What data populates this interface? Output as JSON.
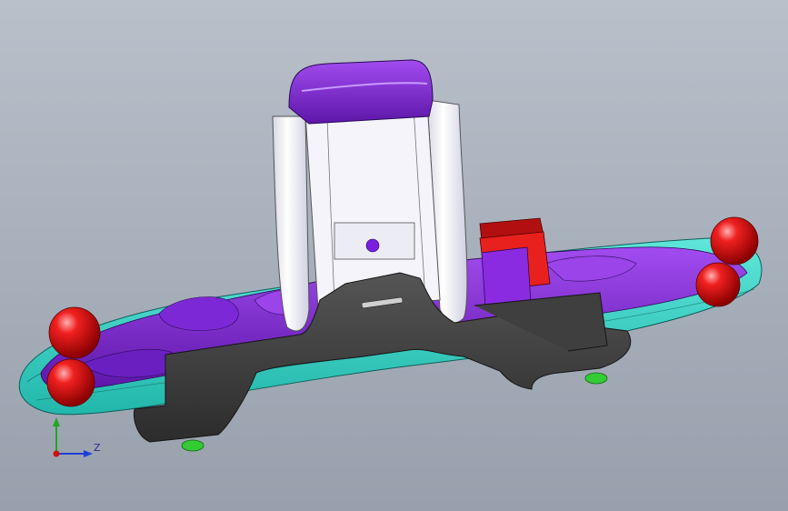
{
  "viewport": {
    "background_top": "#b9c0ca",
    "background_bottom": "#98a0ad"
  },
  "model": {
    "colors": {
      "base_plate": "#2fd6c8",
      "purple_body": "#8a2be2",
      "purple_dark": "#5b14a8",
      "white_clip": "#f2f2f6",
      "dark_bracket": "#3c3c3c",
      "red_spheres": "#e01010",
      "red_block": "#e8201e",
      "green_feet": "#33cc33"
    }
  },
  "triad": {
    "z_label": "Z",
    "colors": {
      "x": "#1f3fd6",
      "y": "#1ea81e",
      "origin": "#d01010"
    }
  }
}
